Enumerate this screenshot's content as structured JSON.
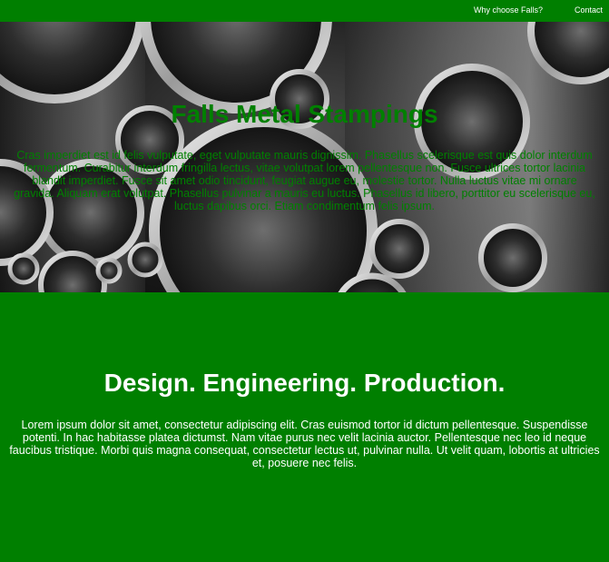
{
  "nav": {
    "why_label": "Why choose Falls?",
    "contact_label": "Contact"
  },
  "hero": {
    "title": "Falls Metal Stampings",
    "text": "Cras imperdiet est id felis vulputate, eget vulputate mauris dignissim. Phasellus scelerisque est quis dolor interdum fermentum. Curabitur interdum fringilla lectus, vitae volutpat lorem pellentesque non. Fusce ultrices tortor lacinia blandit imperdiet. Fusce sit amet odio tincidunt, feugiat augue eu, molestie tortor. Nulla luctus vitae mi ornare gravida. Aliquam erat volutpat. Phasellus pulvinar a mauris eu luctus. Phasellus id libero, porttitor eu scelerisque eu, luctus dapibus orci. Etiam condimentum felis ipsum."
  },
  "section": {
    "heading": "Design. Engineering. Production.",
    "text": "Lorem ipsum dolor sit amet, consectetur adipiscing elit. Cras euismod tortor id dictum pellentesque. Suspendisse potenti. In hac habitasse platea dictumst. Nam vitae purus nec velit lacinia auctor. Pellentesque nec leo id neque faucibus tristique. Morbi quis magna consequat, consectetur lectus ut, pulvinar nulla. Ut velit quam, lobortis at ultricies et, posuere nec felis."
  },
  "colors": {
    "brand_green": "#007f00",
    "hero_title_green": "#008000",
    "text_white": "#ffffff"
  }
}
